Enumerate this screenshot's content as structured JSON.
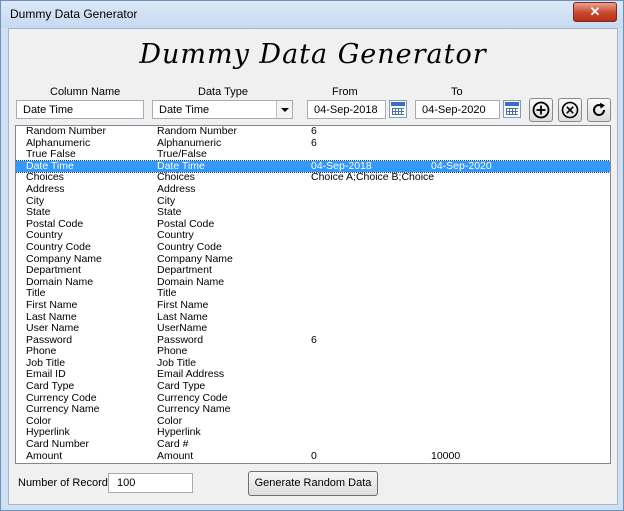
{
  "window": {
    "title": "Dummy Data Generator",
    "close_glyph": "✕"
  },
  "header": {
    "app_title": "Dummy Data Generator"
  },
  "form": {
    "labels": {
      "column_name": "Column Name",
      "data_type": "Data Type",
      "from": "From",
      "to": "To"
    },
    "column_name_value": "Date Time",
    "data_type_value": "Date Time",
    "from_value": "04-Sep-2018",
    "to_value": "04-Sep-2020"
  },
  "actions": {
    "add_icon": "plus-circle-icon",
    "remove_icon": "x-circle-icon",
    "refresh_icon": "refresh-icon"
  },
  "list": {
    "selected_index": 3,
    "rows": [
      [
        "Random Number",
        "Random Number",
        "6",
        ""
      ],
      [
        "Alphanumeric",
        "Alphanumeric",
        "6",
        ""
      ],
      [
        "True False",
        "True/False",
        "",
        ""
      ],
      [
        "Date Time",
        "Date Time",
        "04-Sep-2018",
        "04-Sep-2020"
      ],
      [
        "Choices",
        "Choices",
        "Choice A;Choice B;Choice",
        ""
      ],
      [
        "Address",
        "Address",
        "",
        ""
      ],
      [
        "City",
        "City",
        "",
        ""
      ],
      [
        "State",
        "State",
        "",
        ""
      ],
      [
        "Postal Code",
        "Postal Code",
        "",
        ""
      ],
      [
        "Country",
        "Country",
        "",
        ""
      ],
      [
        "Country Code",
        "Country Code",
        "",
        ""
      ],
      [
        "Company Name",
        "Company Name",
        "",
        ""
      ],
      [
        "Department",
        "Department",
        "",
        ""
      ],
      [
        "Domain Name",
        "Domain Name",
        "",
        ""
      ],
      [
        "Title",
        "Title",
        "",
        ""
      ],
      [
        "First Name",
        "First Name",
        "",
        ""
      ],
      [
        "Last Name",
        "Last Name",
        "",
        ""
      ],
      [
        "User Name",
        "UserName",
        "",
        ""
      ],
      [
        "Password",
        "Password",
        "6",
        ""
      ],
      [
        "Phone",
        "Phone",
        "",
        ""
      ],
      [
        "Job Title",
        "Job Title",
        "",
        ""
      ],
      [
        "Email ID",
        "Email Address",
        "",
        ""
      ],
      [
        "Card Type",
        "Card Type",
        "",
        ""
      ],
      [
        "Currency Code",
        "Currency Code",
        "",
        ""
      ],
      [
        "Currency Name",
        "Currency Name",
        "",
        ""
      ],
      [
        "Color",
        "Color",
        "",
        ""
      ],
      [
        "Hyperlink",
        "Hyperlink",
        "",
        ""
      ],
      [
        "Card Number",
        "Card #",
        "",
        ""
      ],
      [
        "Amount",
        "Amount",
        "0",
        "10000"
      ]
    ]
  },
  "footer": {
    "records_label": "Number of Records:",
    "records_value": "100",
    "generate_label": "Generate Random Data"
  },
  "colors": {
    "selection": "#3399ff",
    "title_bar": "#cfe0f3",
    "close_button": "#c8462c"
  }
}
